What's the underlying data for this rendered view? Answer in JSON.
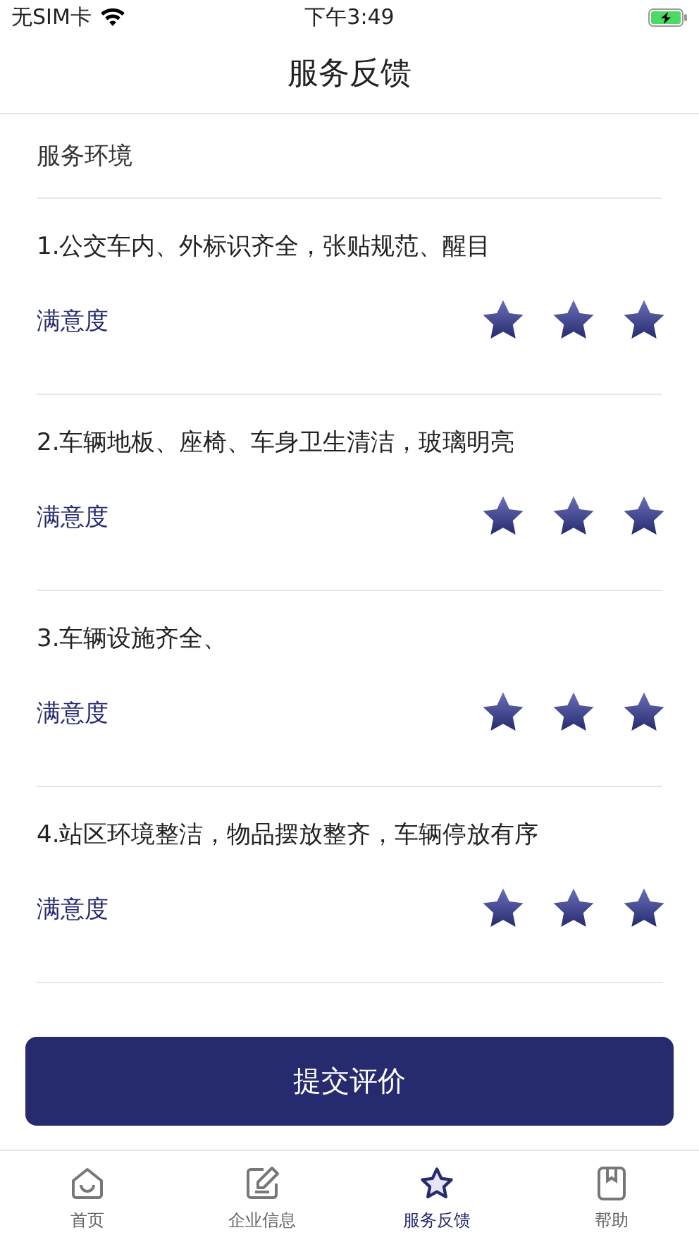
{
  "status_bar": {
    "carrier": "无SIM卡",
    "time": "下午3:49"
  },
  "title": "服务反馈",
  "section": "服务环境",
  "questions": [
    {
      "text": "1.公交车内、外标识齐全，张贴规范、醒目",
      "label": "满意度",
      "stars": 3
    },
    {
      "text": "2.车辆地板、座椅、车身卫生清洁，玻璃明亮",
      "label": "满意度",
      "stars": 3
    },
    {
      "text": "3.车辆设施齐全、",
      "label": "满意度",
      "stars": 3
    },
    {
      "text": "4.站区环境整洁，物品摆放整齐，车辆停放有序",
      "label": "满意度",
      "stars": 3
    }
  ],
  "submit_button": "提交评价",
  "tabs": [
    {
      "label": "首页",
      "selected": false
    },
    {
      "label": "企业信息",
      "selected": false
    },
    {
      "label": "服务反馈",
      "selected": true
    },
    {
      "label": "帮助",
      "selected": false
    }
  ]
}
